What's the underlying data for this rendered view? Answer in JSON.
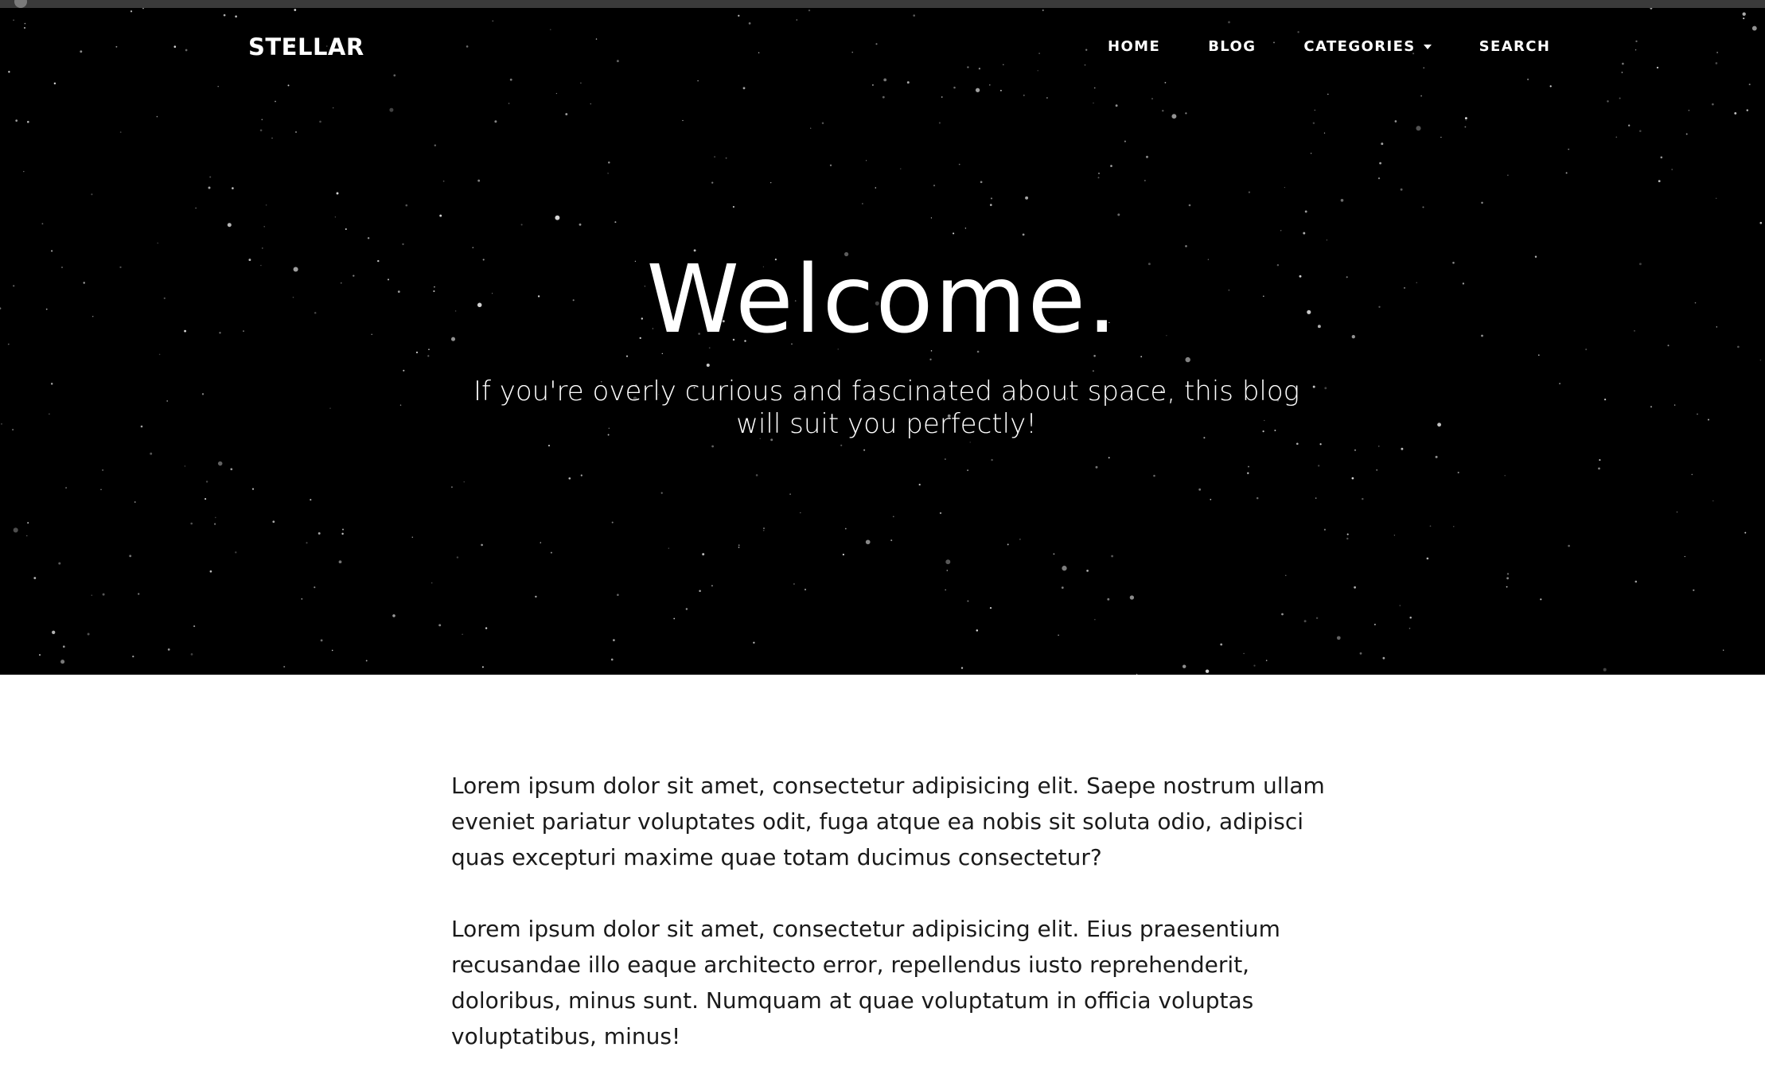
{
  "nav": {
    "brand": "STELLAR",
    "links": [
      "HOME",
      "BLOG",
      "CATEGORIES",
      "SEARCH"
    ]
  },
  "hero": {
    "title": "Welcome.",
    "subtitle": "If you're overly curious and fascinated about space, this blog will suit you perfectly!"
  },
  "content": {
    "paragraphs": [
      "Lorem ipsum dolor sit amet, consectetur adipisicing elit. Saepe nostrum ullam eveniet pariatur voluptates odit, fuga atque ea nobis sit soluta odio, adipisci quas excepturi maxime quae totam ducimus consectetur?",
      "Lorem ipsum dolor sit amet, consectetur adipisicing elit. Eius praesentium recusandae illo eaque architecto error, repellendus iusto reprehenderit, doloribus, minus sunt. Numquam at quae voluptatum in officia voluptas voluptatibus, minus!"
    ]
  },
  "icons": {
    "categories_dropdown": "caret-down-icon"
  },
  "colors": {
    "hero_background": "#000000",
    "text_light": "#ffffff",
    "text_dark": "#1a1a1a"
  }
}
